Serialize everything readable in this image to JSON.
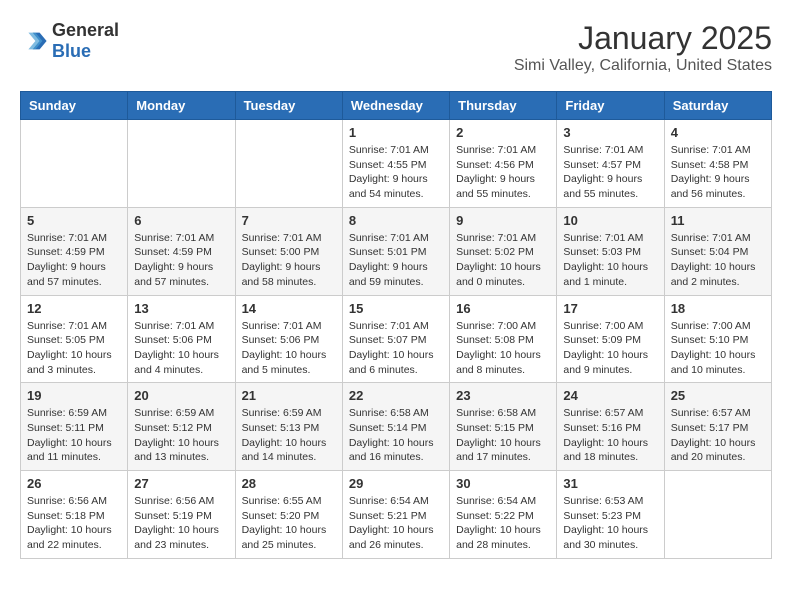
{
  "header": {
    "logo": {
      "general": "General",
      "blue": "Blue"
    },
    "title": "January 2025",
    "subtitle": "Simi Valley, California, United States"
  },
  "weekdays": [
    "Sunday",
    "Monday",
    "Tuesday",
    "Wednesday",
    "Thursday",
    "Friday",
    "Saturday"
  ],
  "weeks": [
    [
      {
        "day": "",
        "info": ""
      },
      {
        "day": "",
        "info": ""
      },
      {
        "day": "",
        "info": ""
      },
      {
        "day": "1",
        "info": "Sunrise: 7:01 AM\nSunset: 4:55 PM\nDaylight: 9 hours and 54 minutes."
      },
      {
        "day": "2",
        "info": "Sunrise: 7:01 AM\nSunset: 4:56 PM\nDaylight: 9 hours and 55 minutes."
      },
      {
        "day": "3",
        "info": "Sunrise: 7:01 AM\nSunset: 4:57 PM\nDaylight: 9 hours and 55 minutes."
      },
      {
        "day": "4",
        "info": "Sunrise: 7:01 AM\nSunset: 4:58 PM\nDaylight: 9 hours and 56 minutes."
      }
    ],
    [
      {
        "day": "5",
        "info": "Sunrise: 7:01 AM\nSunset: 4:59 PM\nDaylight: 9 hours and 57 minutes."
      },
      {
        "day": "6",
        "info": "Sunrise: 7:01 AM\nSunset: 4:59 PM\nDaylight: 9 hours and 57 minutes."
      },
      {
        "day": "7",
        "info": "Sunrise: 7:01 AM\nSunset: 5:00 PM\nDaylight: 9 hours and 58 minutes."
      },
      {
        "day": "8",
        "info": "Sunrise: 7:01 AM\nSunset: 5:01 PM\nDaylight: 9 hours and 59 minutes."
      },
      {
        "day": "9",
        "info": "Sunrise: 7:01 AM\nSunset: 5:02 PM\nDaylight: 10 hours and 0 minutes."
      },
      {
        "day": "10",
        "info": "Sunrise: 7:01 AM\nSunset: 5:03 PM\nDaylight: 10 hours and 1 minute."
      },
      {
        "day": "11",
        "info": "Sunrise: 7:01 AM\nSunset: 5:04 PM\nDaylight: 10 hours and 2 minutes."
      }
    ],
    [
      {
        "day": "12",
        "info": "Sunrise: 7:01 AM\nSunset: 5:05 PM\nDaylight: 10 hours and 3 minutes."
      },
      {
        "day": "13",
        "info": "Sunrise: 7:01 AM\nSunset: 5:06 PM\nDaylight: 10 hours and 4 minutes."
      },
      {
        "day": "14",
        "info": "Sunrise: 7:01 AM\nSunset: 5:06 PM\nDaylight: 10 hours and 5 minutes."
      },
      {
        "day": "15",
        "info": "Sunrise: 7:01 AM\nSunset: 5:07 PM\nDaylight: 10 hours and 6 minutes."
      },
      {
        "day": "16",
        "info": "Sunrise: 7:00 AM\nSunset: 5:08 PM\nDaylight: 10 hours and 8 minutes."
      },
      {
        "day": "17",
        "info": "Sunrise: 7:00 AM\nSunset: 5:09 PM\nDaylight: 10 hours and 9 minutes."
      },
      {
        "day": "18",
        "info": "Sunrise: 7:00 AM\nSunset: 5:10 PM\nDaylight: 10 hours and 10 minutes."
      }
    ],
    [
      {
        "day": "19",
        "info": "Sunrise: 6:59 AM\nSunset: 5:11 PM\nDaylight: 10 hours and 11 minutes."
      },
      {
        "day": "20",
        "info": "Sunrise: 6:59 AM\nSunset: 5:12 PM\nDaylight: 10 hours and 13 minutes."
      },
      {
        "day": "21",
        "info": "Sunrise: 6:59 AM\nSunset: 5:13 PM\nDaylight: 10 hours and 14 minutes."
      },
      {
        "day": "22",
        "info": "Sunrise: 6:58 AM\nSunset: 5:14 PM\nDaylight: 10 hours and 16 minutes."
      },
      {
        "day": "23",
        "info": "Sunrise: 6:58 AM\nSunset: 5:15 PM\nDaylight: 10 hours and 17 minutes."
      },
      {
        "day": "24",
        "info": "Sunrise: 6:57 AM\nSunset: 5:16 PM\nDaylight: 10 hours and 18 minutes."
      },
      {
        "day": "25",
        "info": "Sunrise: 6:57 AM\nSunset: 5:17 PM\nDaylight: 10 hours and 20 minutes."
      }
    ],
    [
      {
        "day": "26",
        "info": "Sunrise: 6:56 AM\nSunset: 5:18 PM\nDaylight: 10 hours and 22 minutes."
      },
      {
        "day": "27",
        "info": "Sunrise: 6:56 AM\nSunset: 5:19 PM\nDaylight: 10 hours and 23 minutes."
      },
      {
        "day": "28",
        "info": "Sunrise: 6:55 AM\nSunset: 5:20 PM\nDaylight: 10 hours and 25 minutes."
      },
      {
        "day": "29",
        "info": "Sunrise: 6:54 AM\nSunset: 5:21 PM\nDaylight: 10 hours and 26 minutes."
      },
      {
        "day": "30",
        "info": "Sunrise: 6:54 AM\nSunset: 5:22 PM\nDaylight: 10 hours and 28 minutes."
      },
      {
        "day": "31",
        "info": "Sunrise: 6:53 AM\nSunset: 5:23 PM\nDaylight: 10 hours and 30 minutes."
      },
      {
        "day": "",
        "info": ""
      }
    ]
  ]
}
